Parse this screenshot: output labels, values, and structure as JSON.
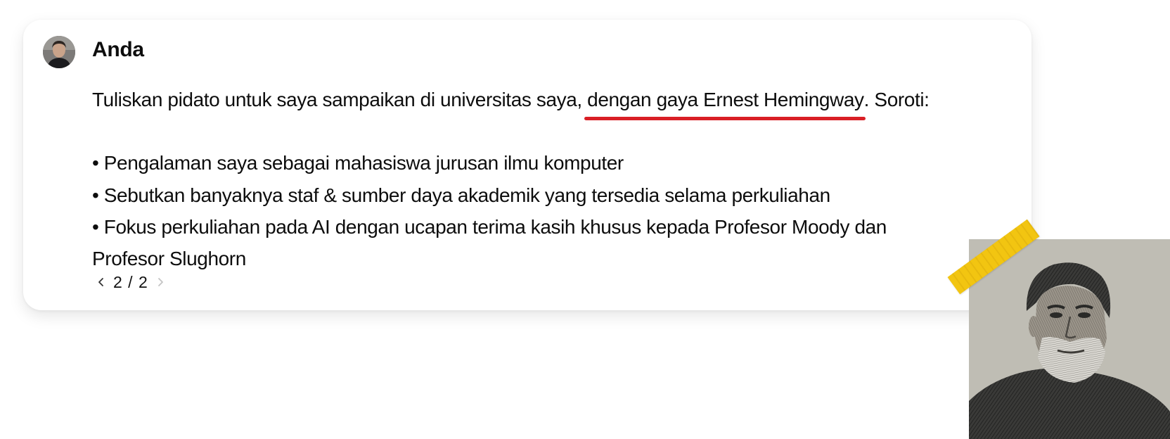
{
  "message": {
    "author": "Anda",
    "avatar_icon": "user-avatar",
    "line1_before": "Tuliskan pidato untuk saya sampaikan di universitas saya,",
    "line1_highlight": "dengan gaya Ernest Hemingway",
    "line1_after": ". Soroti:",
    "bullets": [
      "• Pengalaman saya sebagai mahasiswa jurusan ilmu komputer",
      "• Sebutkan banyaknya staf & sumber daya akademik yang tersedia selama perkuliahan",
      "• Fokus perkuliahan pada AI dengan ucapan terima kasih khusus kepada Profesor Moody dan"
    ],
    "continuation": "Profesor Slughorn",
    "highlight_color": "#d91f26"
  },
  "pager": {
    "prev_icon": "chevron-left-icon",
    "next_icon": "chevron-right-icon",
    "label": "2 / 2"
  },
  "overlay": {
    "tape_color": "#f2c511",
    "portrait_icon": "bearded-man-portrait"
  }
}
